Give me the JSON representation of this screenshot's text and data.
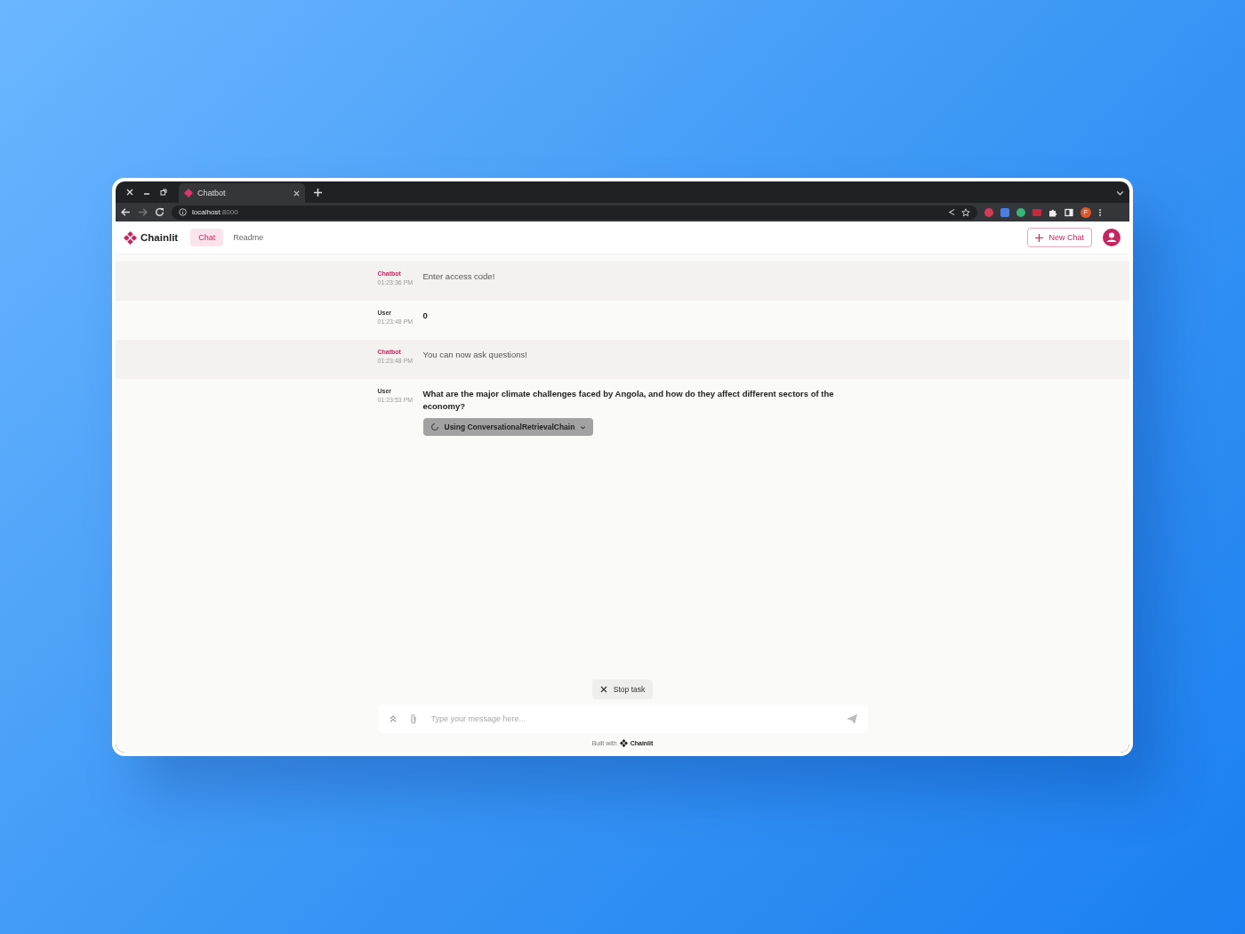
{
  "browser": {
    "tab_title": "Chatbot",
    "url_host": "localhost",
    "url_port": ":8000",
    "profile_initial": "F"
  },
  "app": {
    "logo_text": "Chainlit",
    "nav": [
      {
        "label": "Chat",
        "selected": true
      },
      {
        "label": "Readme",
        "selected": false
      }
    ],
    "new_chat": "New Chat"
  },
  "messages": [
    {
      "kind": "bot",
      "author": "Chatbot",
      "time": "01:23:36 PM",
      "text": "Enter access code!"
    },
    {
      "kind": "user",
      "author": "User",
      "time": "01:23:48 PM",
      "text": "0"
    },
    {
      "kind": "bot",
      "author": "Chatbot",
      "time": "01:23:48 PM",
      "text": "You can now ask questions!"
    },
    {
      "kind": "user",
      "author": "User",
      "time": "01:23:53 PM",
      "text": "What are the major climate challenges faced by Angola, and how do they affect different sectors of the economy?",
      "step": "Using ConversationalRetrievalChain"
    }
  ],
  "stop_task": "Stop task",
  "composer": {
    "placeholder": "Type your message here..."
  },
  "footer": {
    "built_with": "Built with",
    "brand": "Chainlit"
  }
}
